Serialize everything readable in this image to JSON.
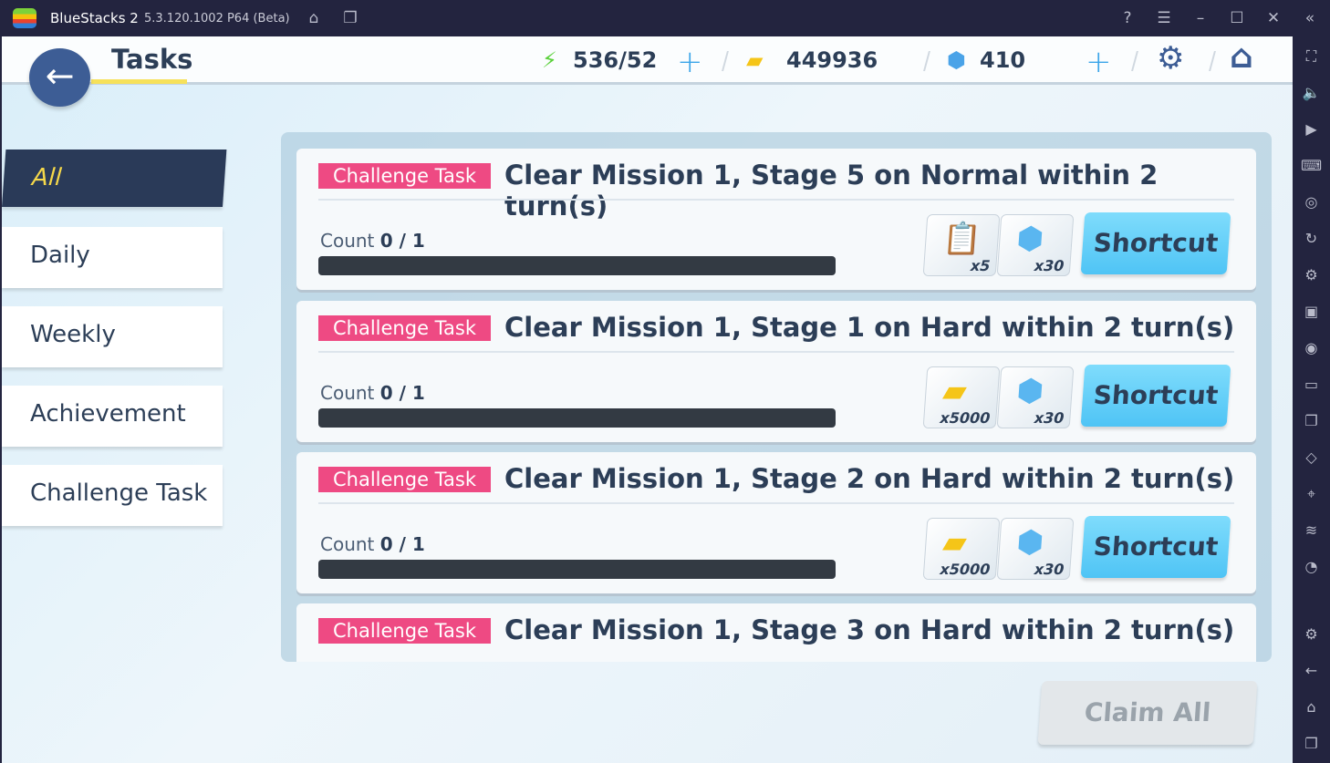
{
  "window": {
    "app_name": "BlueStacks 2",
    "version": "5.3.120.1002 P64 (Beta)"
  },
  "header": {
    "title": "Tasks",
    "stamina": "536/52",
    "coins": "449936",
    "gems": "410"
  },
  "tabs": [
    {
      "label": "All",
      "active": true
    },
    {
      "label": "Daily"
    },
    {
      "label": "Weekly"
    },
    {
      "label": "Achievement"
    },
    {
      "label": "Challenge Task"
    }
  ],
  "tasks": [
    {
      "badge": "Challenge Task",
      "title": "Clear Mission 1, Stage 5 on Normal within 2 turn(s)",
      "count_label": "Count",
      "count": "0 / 1",
      "progress": 0,
      "rewards": [
        {
          "icon": "report-icon",
          "qty": "x5"
        },
        {
          "icon": "crystal-icon",
          "qty": "x30"
        }
      ],
      "button": "Shortcut"
    },
    {
      "badge": "Challenge Task",
      "title": "Clear Mission 1, Stage 1 on Hard within 2 turn(s)",
      "count_label": "Count",
      "count": "0 / 1",
      "progress": 0,
      "rewards": [
        {
          "icon": "coin-card-icon",
          "qty": "x5000"
        },
        {
          "icon": "crystal-icon",
          "qty": "x30"
        }
      ],
      "button": "Shortcut"
    },
    {
      "badge": "Challenge Task",
      "title": "Clear Mission 1, Stage 2 on Hard within 2 turn(s)",
      "count_label": "Count",
      "count": "0 / 1",
      "progress": 0,
      "rewards": [
        {
          "icon": "coin-card-icon",
          "qty": "x5000"
        },
        {
          "icon": "crystal-icon",
          "qty": "x30"
        }
      ],
      "button": "Shortcut"
    },
    {
      "badge": "Challenge Task",
      "title": "Clear Mission 1, Stage 3 on Hard within 2 turn(s)"
    }
  ],
  "claim_all": "Claim All",
  "colors": {
    "badge": "#ee4a83",
    "shortcut": "#4fc4f5",
    "active_tab": "#2a3a58"
  }
}
